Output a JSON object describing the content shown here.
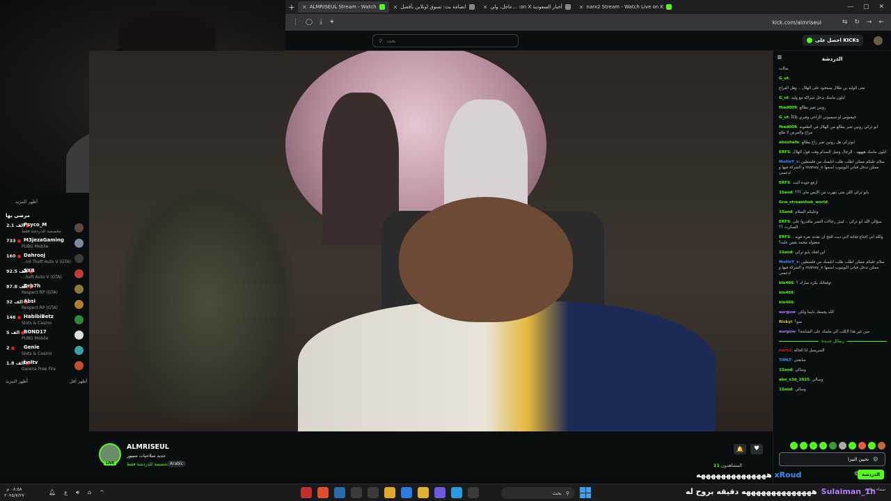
{
  "browser": {
    "tabs": [
      {
        "label": "narx2 Stream - Watch Live on K",
        "active": false
      },
      {
        "label": "عاجل، ولي... :on X أخبار السعودية",
        "active": false
      },
      {
        "label": "انضامة بث: تسوق اونلاين بأفضل",
        "active": false
      },
      {
        "label": "ALMRISEUL Stream - Watch",
        "active": true
      }
    ],
    "new_tab": "+",
    "url": "kick.com/almriseul"
  },
  "kick_header": {
    "search_placeholder": "بحث",
    "get_kicks_label": "احصل على KICKs"
  },
  "sidebar": {
    "show_more_top": "أظهر المزيد",
    "section_title": "مرصي بها",
    "items": [
      {
        "count": "2.1 الف",
        "name": "Psyco_M",
        "category": "مخصصة للدردشة فقط",
        "avatar_color": "#5a4a3e"
      },
      {
        "count": "733",
        "name": "M3jezaGaming",
        "category": "PUBG Mobile",
        "avatar_color": "#7a8aa0"
      },
      {
        "count": "160",
        "name": "Dahrooj",
        "category": "...nd Theft Auto V (GTA)",
        "avatar_color": "#3a3a3a"
      },
      {
        "count": "92.5 الف",
        "name": "SXB",
        "category": "...heft Auto V (GTA)",
        "avatar_color": "#c23b3b"
      },
      {
        "count": "87.8 الف",
        "name": "Drb7h",
        "category": "Respect RP (GTA)",
        "avatar_color": "#8a7a3a"
      },
      {
        "count": "32 الف",
        "name": "Absi",
        "category": "Respect RP (GTA)",
        "avatar_color": "#b08030"
      },
      {
        "count": "146",
        "name": "HabibiBetz",
        "category": "Slots & Casino",
        "avatar_color": "#2d8a3a"
      },
      {
        "count": "5 الف",
        "name": "BOND17",
        "category": "PUBG Mobile",
        "avatar_color": "#dddddd"
      },
      {
        "count": "2",
        "name": "Genie",
        "category": "Slots & Casino",
        "avatar_color": "#3aa0a0"
      },
      {
        "count": "1.8 الف",
        "name": "bnltv",
        "category": "Garena Free Fire",
        "avatar_color": "#c05030"
      }
    ],
    "show_less": "أظهر أقل",
    "show_more_bottom": "أظهر المزيد"
  },
  "stream": {
    "channel_name": "ALMRISEUL",
    "title": "جديد سلاحيات سبيور",
    "category": "مخصصة للدردشة فقط",
    "language": "Arabic",
    "live_badge": "LIVE",
    "viewers_label": "المشاهدون",
    "viewers_count": "11"
  },
  "chat": {
    "title": "الدردشة",
    "messages": [
      {
        "user": "",
        "text": "سالت",
        "color": "#e8e8e8"
      },
      {
        "user": "G_ut",
        "text": "",
        "color": "#53fc18"
      },
      {
        "user": "",
        "text": "متى الوليد بن طلال يستحوذ على الهلال .. وهل الفراغ",
        "color": "#e8e8e8"
      },
      {
        "user": "G_ut",
        "text": "ايلون ماسك يدخل شراكة مع وليد",
        "color": "#53fc18"
      },
      {
        "user": "fhad009",
        "text": "رونين تعيز يطالع",
        "color": "#53fc18"
      },
      {
        "user": "G_ut",
        "text": "جيسوس او سيميوني الزاعي وفيري تلاكاً",
        "color": "#53fc18"
      },
      {
        "user": "fhad009",
        "text": "ابو تركي رونين تعيز يطالع من الهلال في الطعوبه مزاح والمرض لا طلع",
        "color": "#53fc18"
      },
      {
        "user": "aboshafe",
        "text": "ابوتركي هل رونين تعيز راح يطالع",
        "color": "#53fc18"
      },
      {
        "user": "ERFS",
        "text": "ايلون ماسك ههههه ، الرجال وصل الصدام وقت قول الهلال",
        "color": "#53fc18"
      },
      {
        "user": "MoHeY_x",
        "text": "سلام عليكم ممكن اطلب طلب انايسك من فلسطين و الشركة فيها و mohey_x ممكن تدخل قناتي اليوتيوب اسمها ادعمني",
        "color": "#3e8ef7"
      },
      {
        "user": "ERFS",
        "text": "ارفع جودة البث",
        "color": "#53fc18"
      },
      {
        "user": "1Saod",
        "text": "يابو تركي اللي متى بتهرب من الإبس ماي ؟؟؟",
        "color": "#53fc18"
      },
      {
        "user": "0cw_streamhub_world",
        "text": "",
        "color": "#53fc18"
      },
      {
        "user": "1Saod",
        "text": "وعليكم السلام",
        "color": "#53fc18"
      },
      {
        "user": "ERFS",
        "text": "سؤالي الله ابو تركي .. ليش رجالات النصر ماقدروا على السكرت ؟؟",
        "color": "#53fc18"
      },
      {
        "user": "ERFS",
        "text": "والله اني احتاج تجابة لاني ديت اقتح ان تقدنه نغرة فويه ، معقوله محمد بقس عليه؟",
        "color": "#53fc18"
      },
      {
        "user": "1Saod",
        "text": "اين افتك يابو تركي",
        "color": "#53fc18"
      },
      {
        "user": "MoHeY_x",
        "text": "سلام عليكم ممكن اطلب طلب انايسك من فلسطين و الشركة فيها و mohey_x ممكن تدخل قناتي اليوتيوب اسمها ادعمني",
        "color": "#3e8ef7"
      },
      {
        "user": "klo466",
        "text": "توقعاتك بكره مبارك ؟",
        "color": "#53fc18"
      },
      {
        "user": "klo466",
        "text": "",
        "color": "#53fc18"
      },
      {
        "user": "klo466",
        "text": "",
        "color": "#53fc18"
      },
      {
        "user": "aurguw",
        "text": "الله يجمعك دايما ولكن",
        "color": "#b07cff"
      },
      {
        "user": "Rickyi",
        "text": "منو؟",
        "color": "#e8c447"
      },
      {
        "user": "aurguw",
        "text": "مين غير هذا الكلب الي ماسك على الشاشة؟",
        "color": "#b07cff"
      }
    ],
    "new_messages_label": "رسائل جديدة",
    "new_messages": [
      {
        "user": "narx2",
        "text": "السريسل انا الحالة",
        "color": "#e91916"
      },
      {
        "user": "TIMLT",
        "text": "صابقتي",
        "color": "#3e8ef7"
      },
      {
        "user": "1Saod",
        "text": "وسالي",
        "color": "#53fc18"
      },
      {
        "user": "abo_s3d_2025",
        "text": "وسالي",
        "color": "#53fc18"
      },
      {
        "user": "1Saod",
        "text": "وسالي",
        "color": "#53fc18"
      }
    ],
    "input_value": "تحيين البيزا",
    "send_label": "الدردشة"
  },
  "ticker": {
    "name": "xRoud",
    "text": "ههههههههههههههه"
  },
  "ticker2": {
    "name": "Sulaiman_1h",
    "text": "ههههههههههههههه دقيقه بروح له"
  },
  "taskbar": {
    "time": "٠٨:٥٨ م",
    "date": "٢٠٢٥/٧/٢٧",
    "lang": "ع",
    "search_placeholder": "بحث",
    "weather": "سماء صافية"
  }
}
